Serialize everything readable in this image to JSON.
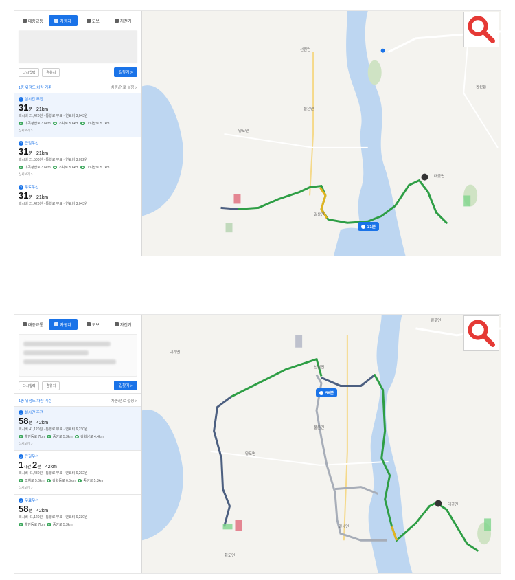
{
  "modes": [
    "대중교통",
    "자동차",
    "도보",
    "자전거"
  ],
  "buttons": {
    "reset": "다시입력",
    "via": "경유지",
    "find": "길찾기 >"
  },
  "shot1": {
    "criteria": "1종 위험도 차량 기준",
    "criteria_setting": "차종/연료 설정 >",
    "routes": [
      {
        "num": "1",
        "tag": "실시간 추천",
        "hours": "",
        "minutes": "31",
        "unit": "분",
        "dist": "21km",
        "fare": "택시비 21,420원 · 통행료 무료 · 연료비 3,043원",
        "roads": [
          "대곡정산로 3.6km",
          "조치로 5.6km",
          "마니산로 5.7km"
        ],
        "detail": "상세보기 >"
      },
      {
        "num": "2",
        "tag": "큰길우선",
        "hours": "",
        "minutes": "31",
        "unit": "분",
        "dist": "21km",
        "fare": "택시비 21,500원 · 통행료 무료 · 연료비 3,092원",
        "roads": [
          "대곡정산로 3.6km",
          "조치로 5.6km",
          "마니산로 5.7km"
        ],
        "detail": "상세보기 >"
      },
      {
        "num": "3",
        "tag": "무료우선",
        "hours": "",
        "minutes": "31",
        "unit": "분",
        "dist": "21km",
        "fare": "택시비 21,420원 · 통행료 무료 · 연료비 3,043원",
        "roads": [],
        "detail": ""
      }
    ],
    "pill": "31분",
    "labels": [
      "선원면",
      "불은면",
      "양도면",
      "길상면",
      "대곶면",
      "통진읍"
    ]
  },
  "shot2": {
    "criteria": "1종 위험도 차량 기준",
    "criteria_setting": "차종/연료 설정 >",
    "routes": [
      {
        "num": "1",
        "tag": "실시간 추천",
        "hours": "",
        "minutes": "58",
        "unit": "분",
        "dist": "42km",
        "fare": "택시비 41,120원 · 통행료 무료 · 연료비 6,230원",
        "roads": [
          "해안동로 7km",
          "중앙로 5.3km",
          "강화남로 4.4km"
        ],
        "detail": "상세보기 >"
      },
      {
        "num": "2",
        "tag": "큰길우선",
        "hours": "1",
        "minutes": "2",
        "unit": "분",
        "dist": "42km",
        "fare": "택시비 41,480원 · 통행료 무료 · 연료비 6,292원",
        "roads": [
          "조치로 5.6km",
          "강화동로 6.5km",
          "중앙로 5.3km"
        ],
        "detail": "상세보기 >"
      },
      {
        "num": "3",
        "tag": "무료우선",
        "hours": "",
        "minutes": "58",
        "unit": "분",
        "dist": "42km",
        "fare": "택시비 41,120원 · 통행료 무료 · 연료비 6,230원",
        "roads": [
          "해안동로 7km",
          "중앙로 5.3km"
        ],
        "detail": ""
      }
    ],
    "pill": "58분",
    "labels": [
      "내가면",
      "선원면",
      "불은면",
      "양도면",
      "길상면",
      "대곶면",
      "화도면",
      "월곶면"
    ]
  },
  "colors": {
    "primary": "#1a73e8",
    "route_green": "#2e9e45",
    "route_slate": "#4c5f80",
    "route_gray": "#a7adb8",
    "route_yellow": "#e2b321",
    "water": "#bdd6f1",
    "land": "#f4f3ef",
    "search_red": "#e53935"
  },
  "icons": {
    "search": "magnifier-icon",
    "collapse": "chevron-left-icon"
  }
}
